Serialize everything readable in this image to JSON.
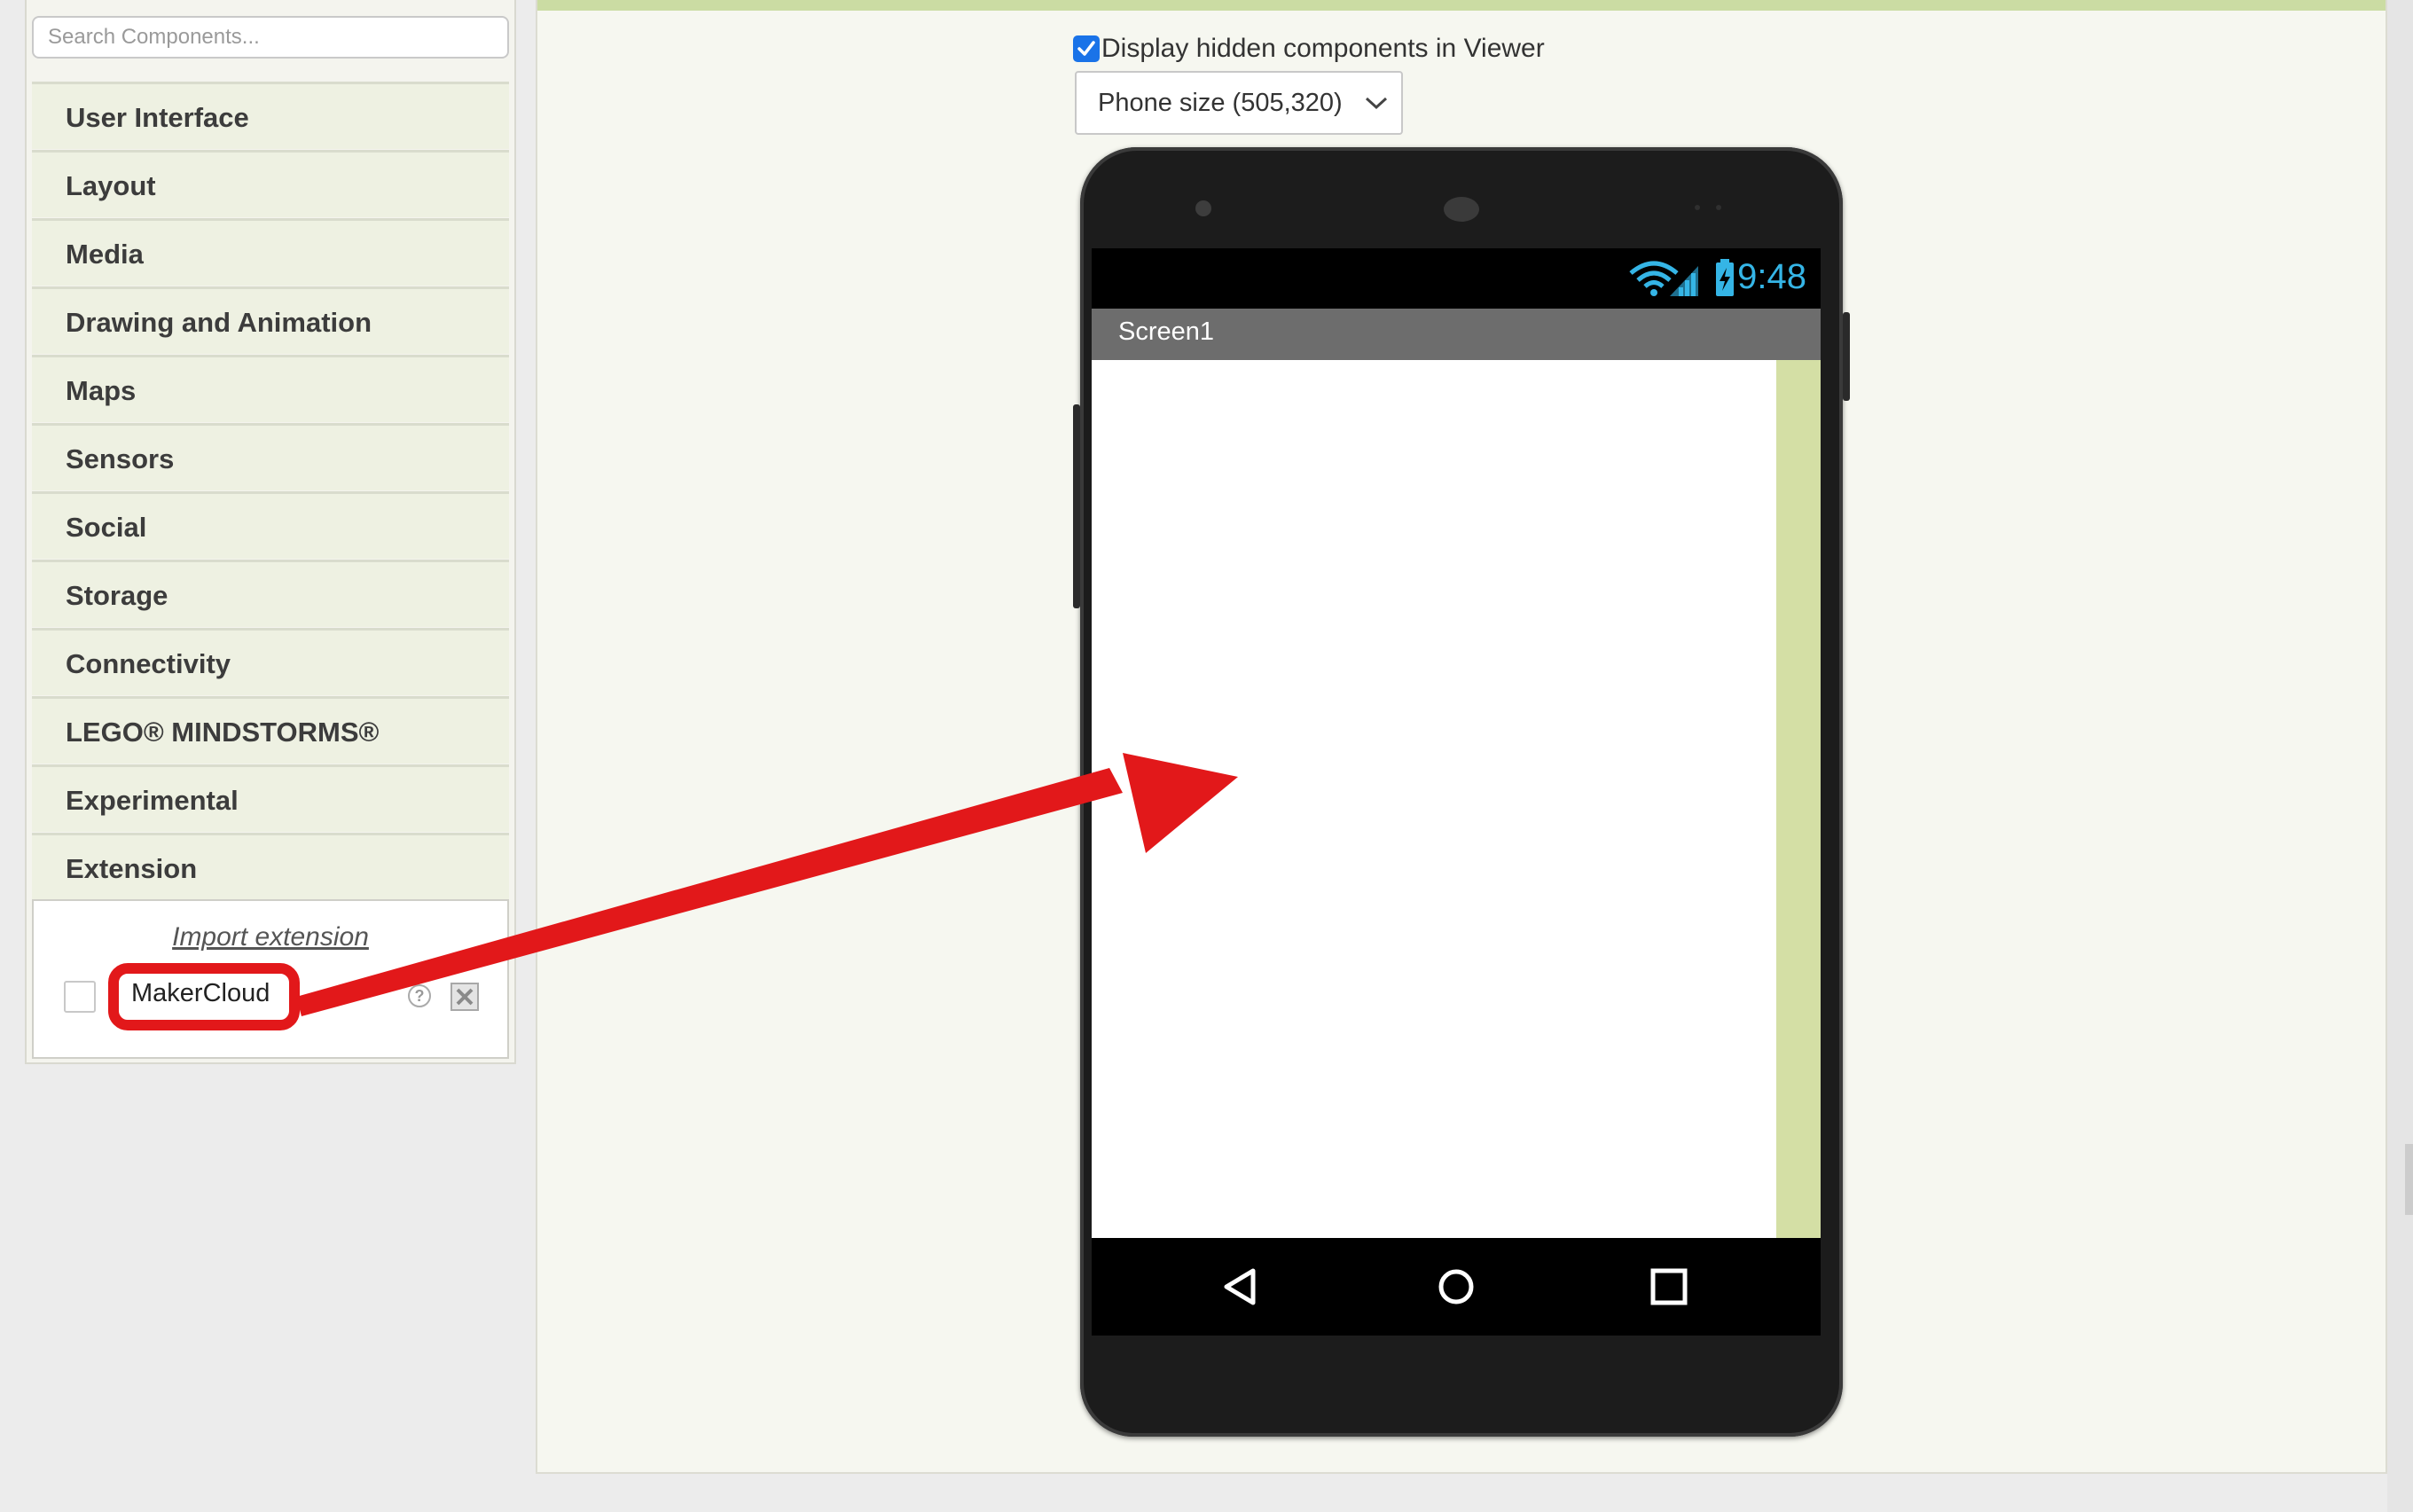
{
  "palette": {
    "search_placeholder": "Search Components...",
    "categories": [
      "User Interface",
      "Layout",
      "Media",
      "Drawing and Animation",
      "Maps",
      "Sensors",
      "Social",
      "Storage",
      "Connectivity",
      "LEGO® MINDSTORMS®",
      "Experimental",
      "Extension"
    ],
    "extension": {
      "import_label": "Import extension",
      "items": [
        {
          "name": "MakerCloud",
          "checked": false,
          "help_icon": "question-circle-icon",
          "delete_icon": "close-box-icon"
        }
      ]
    }
  },
  "viewer": {
    "hidden_components_label": "Display hidden components in Viewer",
    "hidden_components_checked": true,
    "size_selected": "Phone size (505,320)",
    "phone": {
      "time": "9:48",
      "screen_title": "Screen1",
      "status_icons": [
        "wifi-icon",
        "signal-icon",
        "battery-charging-icon"
      ],
      "nav_icons": [
        "back-triangle-icon",
        "home-circle-icon",
        "recents-square-icon"
      ]
    }
  },
  "colors": {
    "accent_green": "#d4dfa5",
    "highlight_red": "#e2181a",
    "clock_blue": "#35b5e6",
    "checkbox_blue": "#1a73e8"
  }
}
